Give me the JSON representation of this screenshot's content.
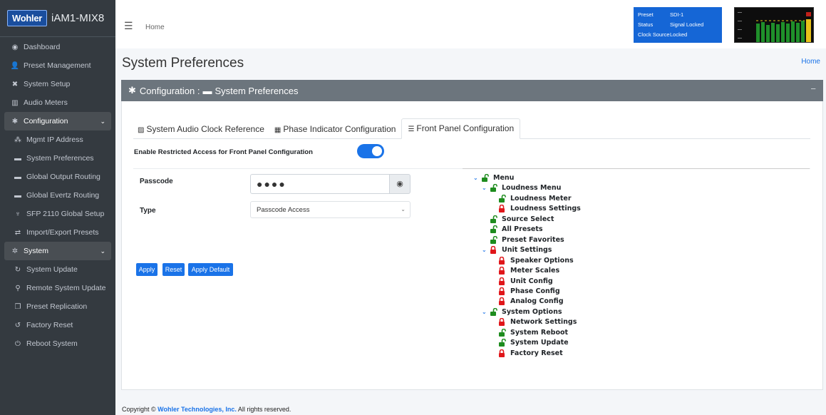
{
  "brand": {
    "logo": "Wohler",
    "model": "iAM1-MIX8"
  },
  "sidebar": {
    "items": [
      {
        "label": "Dashboard",
        "icon": "dashboard-icon"
      },
      {
        "label": "Preset Management",
        "icon": "users-icon"
      },
      {
        "label": "System Setup",
        "icon": "tools-icon"
      },
      {
        "label": "Audio Meters",
        "icon": "bar-chart-icon"
      },
      {
        "label": "Configuration",
        "icon": "gear-icon"
      },
      {
        "label": "Mgmt IP Address",
        "icon": "network-icon"
      },
      {
        "label": "System Preferences",
        "icon": "keyboard-icon"
      },
      {
        "label": "Global Output Routing",
        "icon": "keyboard-icon"
      },
      {
        "label": "Global Evertz Routing",
        "icon": "keyboard-icon"
      },
      {
        "label": "SFP 2110 Global Setup",
        "icon": "plug-icon"
      },
      {
        "label": "Import/Export Presets",
        "icon": "exchange-icon"
      },
      {
        "label": "System",
        "icon": "gears-icon"
      },
      {
        "label": "System Update",
        "icon": "refresh-icon"
      },
      {
        "label": "Remote System Update",
        "icon": "remote-icon"
      },
      {
        "label": "Preset Replication",
        "icon": "copy-icon"
      },
      {
        "label": "Factory Reset",
        "icon": "undo-icon"
      },
      {
        "label": "Reboot System",
        "icon": "power-icon"
      }
    ]
  },
  "topbar": {
    "home": "Home"
  },
  "status": {
    "preset_label": "Preset",
    "preset_value": "SDI-1",
    "status_label": "Status",
    "status_value": "Signal Locked",
    "clock_label": "Clock Source",
    "clock_value": "Locked"
  },
  "page": {
    "title": "System Preferences",
    "breadcrumb": "Home"
  },
  "card": {
    "header_prefix": "Configuration :",
    "header_title": "System Preferences",
    "collapse": "−"
  },
  "tabs": [
    {
      "label": "System Audio Clock Reference",
      "icon": "chart-icon"
    },
    {
      "label": "Phase Indicator Configuration",
      "icon": "grid-icon"
    },
    {
      "label": "Front Panel Configuration",
      "icon": "list-icon"
    }
  ],
  "form": {
    "restrict_label": "Enable Restricted Access for Front Panel Configuration",
    "restrict_enabled": true,
    "passcode_label": "Passcode",
    "passcode_value": "●●●●",
    "type_label": "Type",
    "type_value": "Passcode Access",
    "apply": "Apply",
    "reset": "Reset",
    "apply_default": "Apply Default"
  },
  "tree": [
    {
      "label": "Menu",
      "level": 0,
      "locked": false,
      "expandable": true
    },
    {
      "label": "Loudness Menu",
      "level": 1,
      "locked": false,
      "expandable": true
    },
    {
      "label": "Loudness Meter",
      "level": 2,
      "locked": false,
      "expandable": false
    },
    {
      "label": "Loudness Settings",
      "level": 2,
      "locked": true,
      "expandable": false
    },
    {
      "label": "Source Select",
      "level": 1,
      "locked": false,
      "expandable": false
    },
    {
      "label": "All Presets",
      "level": 1,
      "locked": false,
      "expandable": false
    },
    {
      "label": "Preset Favorites",
      "level": 1,
      "locked": false,
      "expandable": false
    },
    {
      "label": "Unit Settings",
      "level": 1,
      "locked": true,
      "expandable": true
    },
    {
      "label": "Speaker Options",
      "level": 2,
      "locked": true,
      "expandable": false
    },
    {
      "label": "Meter Scales",
      "level": 2,
      "locked": true,
      "expandable": false
    },
    {
      "label": "Unit Config",
      "level": 2,
      "locked": true,
      "expandable": false
    },
    {
      "label": "Phase Config",
      "level": 2,
      "locked": true,
      "expandable": false
    },
    {
      "label": "Analog Config",
      "level": 2,
      "locked": true,
      "expandable": false
    },
    {
      "label": "System Options",
      "level": 1,
      "locked": false,
      "expandable": true
    },
    {
      "label": "Network Settings",
      "level": 2,
      "locked": true,
      "expandable": false
    },
    {
      "label": "System Reboot",
      "level": 2,
      "locked": false,
      "expandable": false
    },
    {
      "label": "System Update",
      "level": 2,
      "locked": false,
      "expandable": false
    },
    {
      "label": "Factory Reset",
      "level": 2,
      "locked": true,
      "expandable": false
    }
  ],
  "footer": {
    "prefix": "Copyright ©",
    "company": "Wohler Technologies, Inc.",
    "suffix": "All rights reserved."
  },
  "colors": {
    "unlocked": "#1e8c1e",
    "locked": "#e0161a",
    "accent": "#1a73e8"
  }
}
